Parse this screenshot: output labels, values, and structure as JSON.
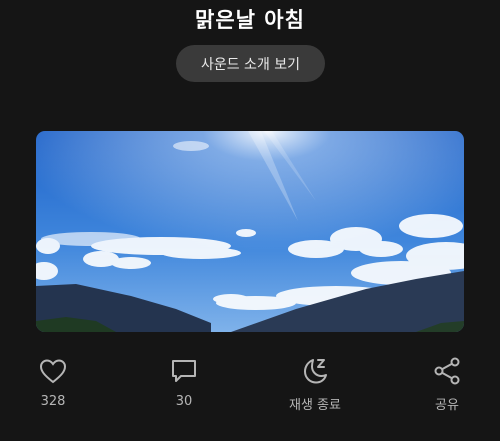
{
  "track": {
    "title": "맑은날 아침"
  },
  "intro_button": {
    "label": "사운드 소개 보기"
  },
  "actions": {
    "like": {
      "icon": "heart-icon",
      "count": "328"
    },
    "comment": {
      "icon": "comment-icon",
      "count": "30"
    },
    "sleep_timer": {
      "icon": "moon-sleep-icon",
      "label": "재생 종료"
    },
    "share": {
      "icon": "share-icon",
      "label": "공유"
    }
  },
  "colors": {
    "background": "#151515",
    "button": "#3a3a3a",
    "muted_text": "#b5b5b5"
  }
}
